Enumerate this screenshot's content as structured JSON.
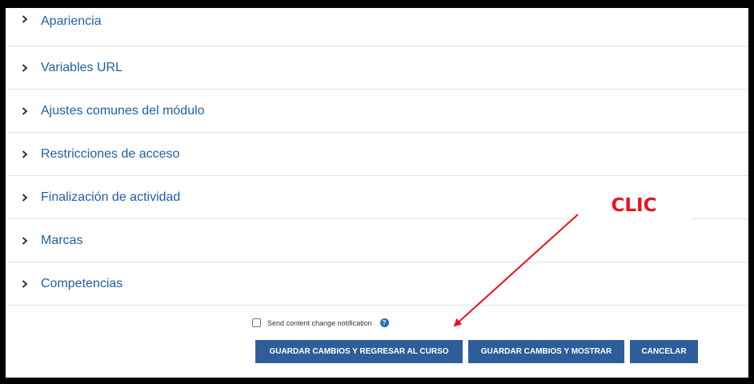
{
  "sections": [
    {
      "label": "Apariencia"
    },
    {
      "label": "Variables URL"
    },
    {
      "label": "Ajustes comunes del módulo"
    },
    {
      "label": "Restricciones de acceso"
    },
    {
      "label": "Finalización de actividad"
    },
    {
      "label": "Marcas"
    },
    {
      "label": "Competencias"
    }
  ],
  "notification": {
    "label": "Send content change notification",
    "checked": false,
    "help_icon": "question-circle-icon"
  },
  "buttons": {
    "save_return": "GUARDAR CAMBIOS Y REGRESAR AL CURSO",
    "save_display": "GUARDAR CAMBIOS Y MOSTRAR",
    "cancel": "CANCELAR"
  },
  "annotation": {
    "text": "CLIC",
    "color": "#e8131b"
  },
  "colors": {
    "button": "#2e5e9a",
    "link": "#1f5fa6"
  }
}
